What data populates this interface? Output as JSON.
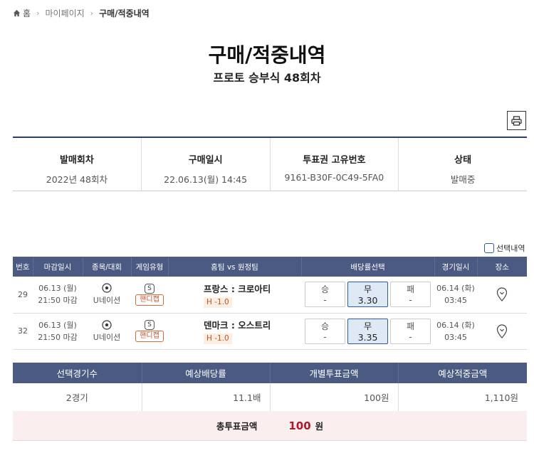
{
  "breadcrumb": {
    "home": "홈",
    "mypage": "마이페이지",
    "current": "구매/적중내역"
  },
  "page": {
    "title": "구매/적중내역",
    "subtitle": "프로토 승부식 48회차"
  },
  "info": {
    "round_head": "발매회차",
    "round_val": "2022년 48회차",
    "date_head": "구매일시",
    "date_val": "22.06.13(월) 14:45",
    "ticket_head": "투표권 고유번호",
    "ticket_val": "9161-B30F-0C49-5FA0",
    "status_head": "상태",
    "status_val": "발매중"
  },
  "select_toggle_label": "선택내역",
  "game_table": {
    "headers": [
      "번호",
      "마감일시",
      "종목/대회",
      "게임유형",
      "홈팀 vs 원정팀",
      "배당률선택",
      "경기일시",
      "장소"
    ],
    "rows": [
      {
        "no": "29",
        "deadline_date": "06.13 (월)",
        "deadline_time": "21:50 마감",
        "league": "U네이션",
        "type_badge": "S",
        "type_label": "핸디캡",
        "teams": "프랑스 : 크로아티",
        "handicap": "H -1.0",
        "win_label": "승",
        "win_odd": "-",
        "draw_label": "무",
        "draw_odd": "3.30",
        "lose_label": "패",
        "lose_odd": "-",
        "game_date": "06.14 (화)",
        "game_time": "03:45"
      },
      {
        "no": "32",
        "deadline_date": "06.13 (월)",
        "deadline_time": "21:50 마감",
        "league": "U네이션",
        "type_badge": "S",
        "type_label": "핸디캡",
        "teams": "덴마크 : 오스트리",
        "handicap": "H -1.0",
        "win_label": "승",
        "win_odd": "-",
        "draw_label": "무",
        "draw_odd": "3.35",
        "lose_label": "패",
        "lose_odd": "-",
        "game_date": "06.14 (화)",
        "game_time": "03:45"
      }
    ]
  },
  "summary": {
    "headers": [
      "선택경기수",
      "예상배당률",
      "개별투표금액",
      "예상적중금액"
    ],
    "values": [
      "2경기",
      "11.1배",
      "100원",
      "1,110원"
    ],
    "total_label": "총투표금액",
    "total_amount": "100",
    "total_unit": "원"
  },
  "colors": {
    "header_bg": "#4a5a82",
    "accent_red": "#b0182b",
    "selected_blue": "#2c5b9e"
  }
}
